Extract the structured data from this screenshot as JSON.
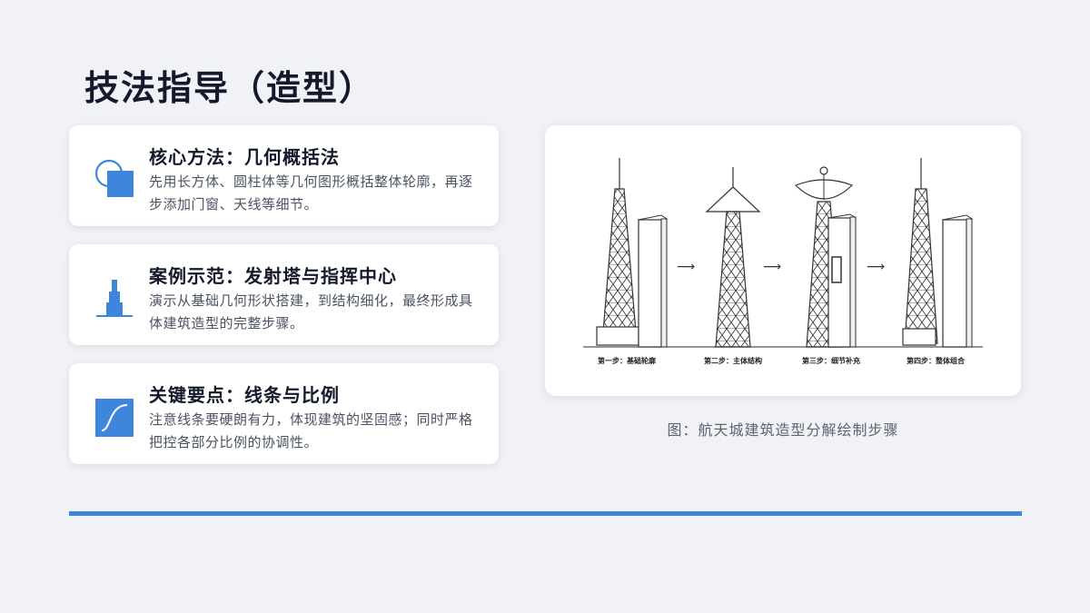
{
  "page": {
    "title": "技法指导（造型）",
    "accent_color": "#3d86dc"
  },
  "cards": [
    {
      "icon": "shapes-icon",
      "heading": "核心方法：几何概括法",
      "body": "先用长方体、圆柱体等几何图形概括整体轮廓，再逐步添加门窗、天线等细节。"
    },
    {
      "icon": "tower-icon",
      "heading": "案例示范：发射塔与指挥中心",
      "body": "演示从基础几何形状搭建，到结构细化，最终形成具体建筑造型的完整步骤。"
    },
    {
      "icon": "curve-icon",
      "heading": "关键要点：线条与比例",
      "body": "注意线条要硬朗有力，体现建筑的坚固感；同时严格把控各部分比例的协调性。"
    }
  ],
  "figure": {
    "steps": [
      {
        "label": "第一步：基础轮廓"
      },
      {
        "label": "第二步：主体结构"
      },
      {
        "label": "第三步：细节补充"
      },
      {
        "label": "第四步：整体组合"
      }
    ],
    "caption": "图：航天城建筑造型分解绘制步骤"
  }
}
